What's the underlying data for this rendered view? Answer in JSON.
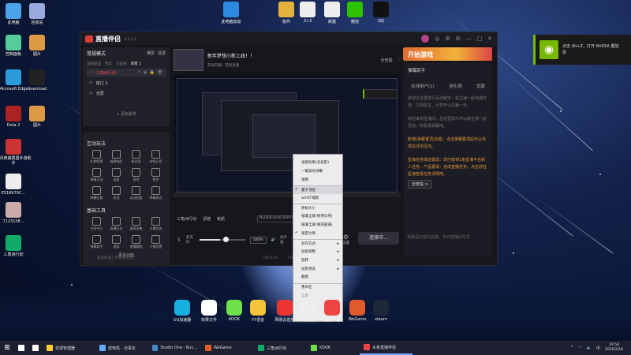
{
  "desktop_icons": [
    {
      "label": "此电脑",
      "color": "#4aa3e8",
      "icon": "computer-icon"
    },
    {
      "label": "回收站",
      "color": "#9ad",
      "icon": "recycle-bin-icon"
    },
    {
      "label": "控制面板",
      "color": "#5c9",
      "icon": "control-panel-icon"
    },
    {
      "label": "图片",
      "color": "#d94",
      "icon": "folder-icon"
    },
    {
      "label": "Microsoft Edge",
      "color": "#2b9cd8",
      "icon": "edge-icon"
    },
    {
      "label": "download",
      "color": "#222",
      "icon": "download-icon"
    },
    {
      "label": "Dota 2",
      "color": "#a22",
      "icon": "dota-icon"
    },
    {
      "label": "图片",
      "color": "#d94",
      "icon": "folder-icon"
    },
    {
      "label": "腾讯英雄联盟手游助手",
      "color": "#c33",
      "icon": "game-icon"
    },
    {
      "label": "E518970C...",
      "color": "#eee",
      "icon": "file-icon"
    },
    {
      "label": "7123158...",
      "color": "#caa",
      "icon": "photo-icon"
    },
    {
      "label": "三角洲行动",
      "color": "#1a6",
      "icon": "delta-icon"
    }
  ],
  "top_icons": [
    {
      "label": "此电脑加加",
      "color": "#2c8ae0"
    },
    {
      "label": "软件",
      "color": "#e3b33c"
    },
    {
      "label": "3+3",
      "color": "#eee"
    },
    {
      "label": "新建",
      "color": "#eee"
    },
    {
      "label": "微信",
      "color": "#2dc100"
    },
    {
      "label": "QQ",
      "color": "#111"
    }
  ],
  "app": {
    "name": "直播伴侣",
    "version": "6.5.5.4",
    "scene_mode": "常规模式",
    "landscape": "横屏",
    "portrait": "竖屏",
    "scene_tabs": [
      "直播画面",
      "我常",
      "可直播",
      "场景 1"
    ],
    "sources": [
      {
        "name": "三角洲行动",
        "active": true
      },
      {
        "name": "窗口 2",
        "active": false
      },
      {
        "name": "全屏",
        "active": false
      }
    ],
    "add_source": "+ 添加素材",
    "interactive_title": "互动玩法",
    "interactive_tools": [
      "礼物投票",
      "福袋抽奖",
      "粉丝团",
      "有钱心愿",
      "弹幕互动",
      "连麦",
      "游戏",
      "更多",
      "弹幕回复",
      "欢迎",
      "自动回复",
      "弹幕表达"
    ],
    "basic_title": "基础工具",
    "basic_tools": [
      "任务中心",
      "直播日志",
      "虚拟形象",
      "主播任务",
      "弹幕助手",
      "道具",
      "直播截图",
      "下播设置"
    ],
    "more_features": "更多功能",
    "stream_title": "新年梦想小新上线！！",
    "stream_category": "游戏开播 · 游戏直播",
    "trial": "全景图",
    "banner_text": "开始游戏",
    "source_bar_label": "三角洲行动",
    "source_bar_items": [
      "滤镜",
      "美颜"
    ],
    "source_field": "NvidiaForceClient-Win64-Shi",
    "mic_label": "麦克风",
    "volume": "100%",
    "speaker_label": "扬声器",
    "settings": "设置",
    "connect": "连接中...",
    "status_items": [
      "如何快速上手直播伴侣?",
      "CPU:14%",
      "内存:52%",
      "未开播"
    ],
    "notice_button": "开播提醒",
    "quality": "推流质量：",
    "bitrate": "比特率：0.0",
    "fps": "0 人"
  },
  "right_panel": {
    "title": "弹幕助手",
    "tabs": [
      "在线用户(1)",
      "送礼榜",
      "贡献"
    ],
    "lines": [
      {
        "text": "欢迎在这里进行互动聊天，和主播一起沟通交流，文明发言，分享开心的每一天。",
        "orange": false
      },
      {
        "text": "欢迎来到直播间，在这里观众可以和主播一起互动，积极发弹幕吧。",
        "orange": false
      },
      {
        "text": "新增[弹幕置顶]功能，点击弹幕置顶后可以出现在评论区内。",
        "orange": true
      },
      {
        "text": "星海任务体验邀请：您已收到1条星海平台新人任务，产品邀请：完成直播任务，点击前往星海查看任务详情吧。",
        "orange": true
      }
    ],
    "goto": "去查看 >",
    "input_placeholder": "弹幕显示窗口设置，仅对直播间可见"
  },
  "context_menu": [
    {
      "label": "滤镜效果(含投影)",
      "check": false,
      "sub": false,
      "sep": false
    },
    {
      "label": "一键美化绿幕",
      "check": false,
      "sub": false,
      "sep": false
    },
    {
      "label": "镜像",
      "check": false,
      "sub": false,
      "sep": false
    },
    {
      "label": "置于顶层",
      "check": true,
      "sub": false,
      "sep": true
    },
    {
      "label": "winRT捕获",
      "check": false,
      "sub": false,
      "sep": false
    },
    {
      "label": "原始大小",
      "check": false,
      "sub": false,
      "sep": true
    },
    {
      "label": "铺满全屏(保持比例)",
      "check": false,
      "sub": false,
      "sep": false
    },
    {
      "label": "铺满全屏(填充铺满)",
      "check": false,
      "sub": false,
      "sep": false
    },
    {
      "label": "锁定比例",
      "check": true,
      "sub": false,
      "sep": false
    },
    {
      "label": "对齐方式",
      "check": false,
      "sub": true,
      "sep": true
    },
    {
      "label": "层级调整",
      "check": false,
      "sub": true,
      "sep": false
    },
    {
      "label": "旋转",
      "check": false,
      "sub": true,
      "sep": false
    },
    {
      "label": "投影预览",
      "check": false,
      "sub": true,
      "sep": false
    },
    {
      "label": "截图",
      "check": false,
      "sub": false,
      "sep": false
    },
    {
      "label": "重命名",
      "check": false,
      "sub": false,
      "sep": true
    },
    {
      "label": "设置",
      "check": false,
      "sub": false,
      "sep": false,
      "dim": true
    },
    {
      "label": "删除",
      "check": false,
      "sub": false,
      "sep": false
    }
  ],
  "nvidia": {
    "line1": "点击 Alt+Z，打开 NVIDIA 叠加",
    "line2": "层"
  },
  "dock": [
    {
      "label": "UU加速器",
      "color": "#18b0e0"
    },
    {
      "label": "效果文件",
      "color": "#fff"
    },
    {
      "label": "KOOK",
      "color": "#6ee04a"
    },
    {
      "label": "YY语音",
      "color": "#f5c43a"
    },
    {
      "label": "网易云音乐",
      "color": "#e33"
    },
    {
      "label": "快速直播",
      "color": "#eee"
    },
    {
      "label": "直播伴侣",
      "color": "#e44"
    },
    {
      "label": "WeGame",
      "color": "#e05a2a"
    },
    {
      "label": "steam",
      "color": "#1b2838"
    }
  ],
  "taskbar": {
    "items": [
      {
        "label": "",
        "color": "#fff"
      },
      {
        "label": "",
        "color": "#fff"
      },
      {
        "label": "资源管理器",
        "color": "#fc3"
      },
      {
        "label": "放电机 - 记事本",
        "color": "#6af"
      },
      {
        "label": "Studio One - Buc...",
        "color": "#48c"
      },
      {
        "label": "WeGame",
        "color": "#e05a2a"
      },
      {
        "label": "三角洲行动",
        "color": "#1a6"
      },
      {
        "label": "KOOK",
        "color": "#6ee04a"
      },
      {
        "label": "头条直播伴侣",
        "color": "#e44"
      }
    ],
    "ime": "中",
    "time": "19:58",
    "date": "2026/2/18"
  }
}
